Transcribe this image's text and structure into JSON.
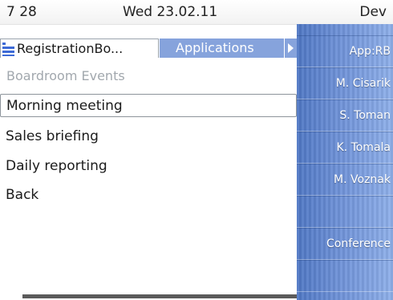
{
  "status_bar": {
    "time": "7 28",
    "date": "Wed 23.02.11",
    "user": "Dev"
  },
  "tabs": {
    "active_label": "RegistrationBo...",
    "inactive_label": "Applications",
    "icon": "menu-list-icon"
  },
  "list": {
    "title": "Boardroom Events",
    "items": [
      {
        "label": "Morning meeting",
        "selected": true
      },
      {
        "label": "Sales briefing"
      },
      {
        "label": "Daily reporting"
      },
      {
        "label": "Back"
      }
    ]
  },
  "softkeys": [
    {
      "label": "App:RB"
    },
    {
      "label": "M. Cisarik"
    },
    {
      "label": "S. Toman"
    },
    {
      "label": "K. Tomala"
    },
    {
      "label": "M. Voznak"
    },
    {
      "label": ""
    },
    {
      "label": "Conference"
    },
    {
      "label": ""
    }
  ],
  "colors": {
    "accent": "#86a3dc",
    "softkey_dark": "#4f77c4",
    "softkey_light": "#8fb0ea",
    "title_gray": "#a2a8ae"
  }
}
